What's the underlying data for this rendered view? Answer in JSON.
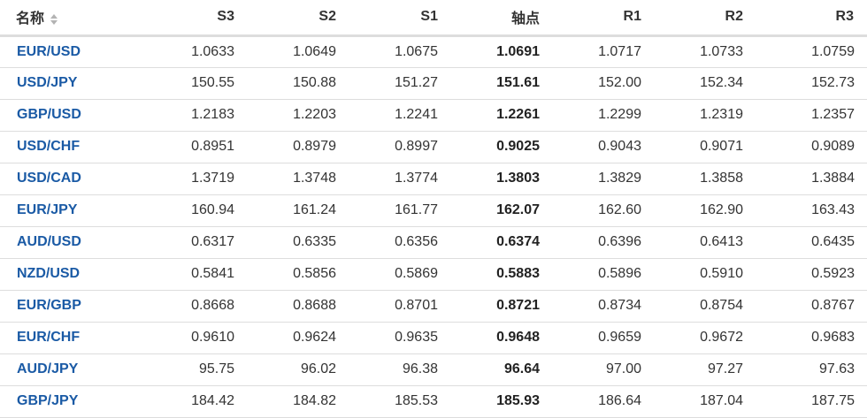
{
  "header": {
    "name_label": "名称",
    "columns": [
      "S3",
      "S2",
      "S1",
      "轴点",
      "R1",
      "R2",
      "R3"
    ]
  },
  "rows": [
    {
      "pair": "EUR/USD",
      "values": [
        "1.0633",
        "1.0649",
        "1.0675",
        "1.0691",
        "1.0717",
        "1.0733",
        "1.0759"
      ]
    },
    {
      "pair": "USD/JPY",
      "values": [
        "150.55",
        "150.88",
        "151.27",
        "151.61",
        "152.00",
        "152.34",
        "152.73"
      ]
    },
    {
      "pair": "GBP/USD",
      "values": [
        "1.2183",
        "1.2203",
        "1.2241",
        "1.2261",
        "1.2299",
        "1.2319",
        "1.2357"
      ]
    },
    {
      "pair": "USD/CHF",
      "values": [
        "0.8951",
        "0.8979",
        "0.8997",
        "0.9025",
        "0.9043",
        "0.9071",
        "0.9089"
      ]
    },
    {
      "pair": "USD/CAD",
      "values": [
        "1.3719",
        "1.3748",
        "1.3774",
        "1.3803",
        "1.3829",
        "1.3858",
        "1.3884"
      ]
    },
    {
      "pair": "EUR/JPY",
      "values": [
        "160.94",
        "161.24",
        "161.77",
        "162.07",
        "162.60",
        "162.90",
        "163.43"
      ]
    },
    {
      "pair": "AUD/USD",
      "values": [
        "0.6317",
        "0.6335",
        "0.6356",
        "0.6374",
        "0.6396",
        "0.6413",
        "0.6435"
      ]
    },
    {
      "pair": "NZD/USD",
      "values": [
        "0.5841",
        "0.5856",
        "0.5869",
        "0.5883",
        "0.5896",
        "0.5910",
        "0.5923"
      ]
    },
    {
      "pair": "EUR/GBP",
      "values": [
        "0.8668",
        "0.8688",
        "0.8701",
        "0.8721",
        "0.8734",
        "0.8754",
        "0.8767"
      ]
    },
    {
      "pair": "EUR/CHF",
      "values": [
        "0.9610",
        "0.9624",
        "0.9635",
        "0.9648",
        "0.9659",
        "0.9672",
        "0.9683"
      ]
    },
    {
      "pair": "AUD/JPY",
      "values": [
        "95.75",
        "96.02",
        "96.38",
        "96.64",
        "97.00",
        "97.27",
        "97.63"
      ]
    },
    {
      "pair": "GBP/JPY",
      "values": [
        "184.42",
        "184.82",
        "185.53",
        "185.93",
        "186.64",
        "187.04",
        "187.75"
      ]
    }
  ],
  "icons": {
    "sort": "sort-icon"
  },
  "colors": {
    "link": "#1a5aa5",
    "text": "#333333",
    "border": "#dddddd",
    "header_border": "#dddddd"
  }
}
